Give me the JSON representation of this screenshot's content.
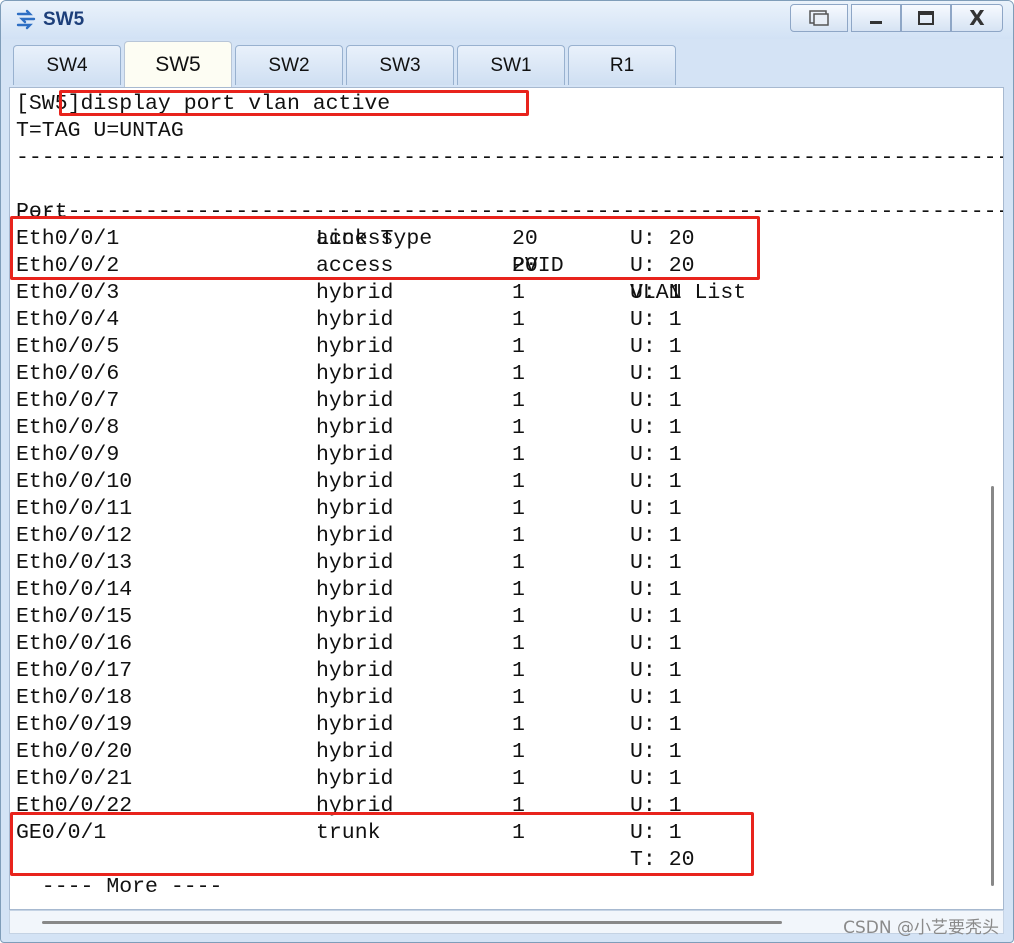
{
  "window": {
    "title": "SW5",
    "close_glyph": "X"
  },
  "tabs": [
    {
      "label": "SW4",
      "active": false
    },
    {
      "label": "SW5",
      "active": true
    },
    {
      "label": "SW2",
      "active": false
    },
    {
      "label": "SW3",
      "active": false
    },
    {
      "label": "SW1",
      "active": false
    },
    {
      "label": "R1",
      "active": false
    }
  ],
  "terminal": {
    "command": "[SW5]display port vlan active",
    "legend": "T=TAG U=UNTAG",
    "separator": "------------------------------------------------------------------------------",
    "headers": {
      "port": "Port",
      "link_type": "Link Type",
      "pvid": "PVID",
      "vlan_list": "VLAN List"
    },
    "rows": [
      {
        "port": "Eth0/0/1",
        "link_type": "access",
        "pvid": "20",
        "vlan": "U: 20"
      },
      {
        "port": "Eth0/0/2",
        "link_type": "access",
        "pvid": "20",
        "vlan": "U: 20"
      },
      {
        "port": "Eth0/0/3",
        "link_type": "hybrid",
        "pvid": "1",
        "vlan": "U: 1"
      },
      {
        "port": "Eth0/0/4",
        "link_type": "hybrid",
        "pvid": "1",
        "vlan": "U: 1"
      },
      {
        "port": "Eth0/0/5",
        "link_type": "hybrid",
        "pvid": "1",
        "vlan": "U: 1"
      },
      {
        "port": "Eth0/0/6",
        "link_type": "hybrid",
        "pvid": "1",
        "vlan": "U: 1"
      },
      {
        "port": "Eth0/0/7",
        "link_type": "hybrid",
        "pvid": "1",
        "vlan": "U: 1"
      },
      {
        "port": "Eth0/0/8",
        "link_type": "hybrid",
        "pvid": "1",
        "vlan": "U: 1"
      },
      {
        "port": "Eth0/0/9",
        "link_type": "hybrid",
        "pvid": "1",
        "vlan": "U: 1"
      },
      {
        "port": "Eth0/0/10",
        "link_type": "hybrid",
        "pvid": "1",
        "vlan": "U: 1"
      },
      {
        "port": "Eth0/0/11",
        "link_type": "hybrid",
        "pvid": "1",
        "vlan": "U: 1"
      },
      {
        "port": "Eth0/0/12",
        "link_type": "hybrid",
        "pvid": "1",
        "vlan": "U: 1"
      },
      {
        "port": "Eth0/0/13",
        "link_type": "hybrid",
        "pvid": "1",
        "vlan": "U: 1"
      },
      {
        "port": "Eth0/0/14",
        "link_type": "hybrid",
        "pvid": "1",
        "vlan": "U: 1"
      },
      {
        "port": "Eth0/0/15",
        "link_type": "hybrid",
        "pvid": "1",
        "vlan": "U: 1"
      },
      {
        "port": "Eth0/0/16",
        "link_type": "hybrid",
        "pvid": "1",
        "vlan": "U: 1"
      },
      {
        "port": "Eth0/0/17",
        "link_type": "hybrid",
        "pvid": "1",
        "vlan": "U: 1"
      },
      {
        "port": "Eth0/0/18",
        "link_type": "hybrid",
        "pvid": "1",
        "vlan": "U: 1"
      },
      {
        "port": "Eth0/0/19",
        "link_type": "hybrid",
        "pvid": "1",
        "vlan": "U: 1"
      },
      {
        "port": "Eth0/0/20",
        "link_type": "hybrid",
        "pvid": "1",
        "vlan": "U: 1"
      },
      {
        "port": "Eth0/0/21",
        "link_type": "hybrid",
        "pvid": "1",
        "vlan": "U: 1"
      },
      {
        "port": "Eth0/0/22",
        "link_type": "hybrid",
        "pvid": "1",
        "vlan": "U: 1"
      },
      {
        "port": "GE0/0/1",
        "link_type": "trunk",
        "pvid": "1",
        "vlan": "U: 1"
      },
      {
        "port": "",
        "link_type": "",
        "pvid": "",
        "vlan": "T: 20"
      }
    ],
    "more": "  ---- More ----"
  },
  "watermark": "CSDN @小艺要秃头",
  "colors": {
    "highlight": "#e8231c",
    "title_text": "#1d3f7a"
  }
}
